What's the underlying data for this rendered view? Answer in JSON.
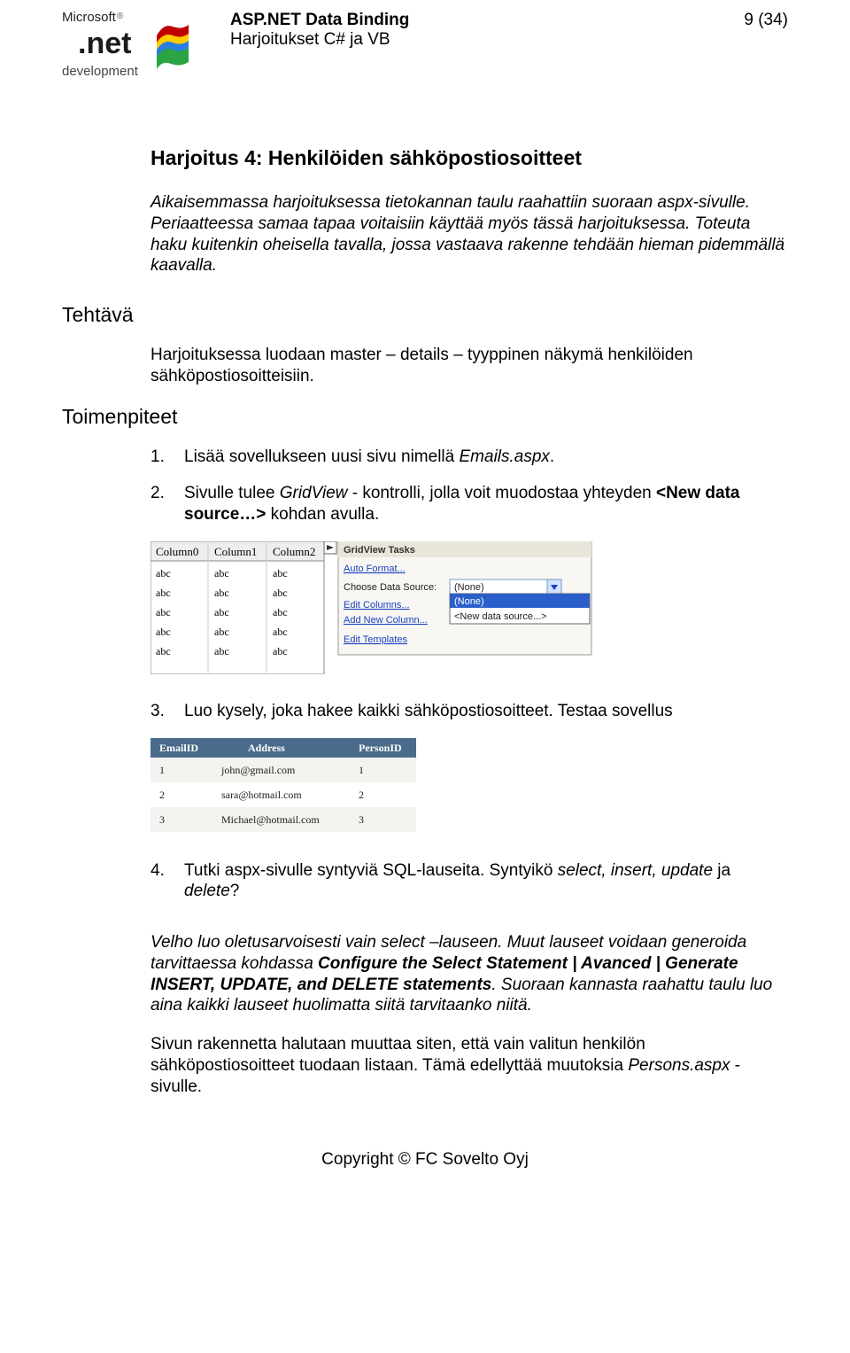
{
  "header": {
    "title": "ASP.NET Data Binding",
    "subtitle": "Harjoitukset C# ja VB",
    "pageInfo": "9 (34)",
    "logo": {
      "top": "Microsoft",
      "brand": ".net",
      "bottom": "development"
    }
  },
  "exercise": {
    "title_prefix": "Harjoitus 4: ",
    "title_bold": "Henkilöiden sähköpostiosoitteet",
    "intro": "Aikaisemmassa harjoituksessa tietokannan taulu raahattiin suoraan aspx-sivulle. Periaatteessa samaa tapaa voitaisiin käyttää myös tässä harjoituksessa. Toteuta haku kuitenkin oheisella tavalla, jossa vastaava rakenne tehdään hieman pidemmällä kaavalla."
  },
  "task": {
    "label": "Tehtävä",
    "text": "Harjoituksessa luodaan master – details – tyyppinen näkymä henkilöiden sähköpostiosoitteisiin."
  },
  "steps": {
    "label": "Toimenpiteet",
    "items": [
      {
        "num": "1.",
        "pre": "Lisää sovellukseen uusi sivu nimellä ",
        "em": "Emails.aspx",
        "post": "."
      },
      {
        "num": "2.",
        "pre": "Sivulle tulee ",
        "em": "GridView",
        "mid": " - kontrolli, jolla voit muodostaa yhteyden ",
        "bold": "<New data source…>",
        "post": " kohdan avulla."
      },
      {
        "num": "3.",
        "text": "Luo kysely, joka hakee kaikki sähköpostiosoitteet. Testaa sovellus"
      },
      {
        "num": "4.",
        "pre": "Tutki aspx-sivulle syntyviä SQL-lauseita. Syntyikö ",
        "em": "select, insert, update",
        "mid": " ja ",
        "em2": "delete",
        "post": "?"
      }
    ]
  },
  "para1": {
    "em1": "Velho luo oletusarvoisesti vain select –lauseen. Muut lauseet voidaan generoida tarvittaessa kohdassa ",
    "bold": "Configure the Select Statement | Avanced | Generate INSERT, UPDATE, and DELETE statements",
    "em2": ". Suoraan kannasta raahattu taulu luo aina kaikki lauseet huolimatta siitä tarvitaanko niitä."
  },
  "para2": {
    "pre": "Sivun rakennetta halutaan muuttaa siten, että vain valitun henkilön sähköpostiosoitteet tuodaan listaan. Tämä edellyttää muutoksia ",
    "em": "Persons.aspx",
    "post": " - sivulle."
  },
  "screenshot1": {
    "gridTitle": "GridView Tasks",
    "autoFormat": "Auto Format...",
    "chooseDS": "Choose Data Source:",
    "selected": "(None)",
    "opt1": "(None)",
    "opt2": "<New data source...>",
    "editCols": "Edit Columns...",
    "addNewCol": "Add New Column...",
    "editTpl": "Edit Templates",
    "cols": [
      "Column0",
      "Column1",
      "Column2"
    ],
    "cell": "abc"
  },
  "screenshot2": {
    "headers": [
      "EmailID",
      "Address",
      "PersonID"
    ],
    "rows": [
      [
        "1",
        "john@gmail.com",
        "1"
      ],
      [
        "2",
        "sara@hotmail.com",
        "2"
      ],
      [
        "3",
        "Michael@hotmail.com",
        "3"
      ]
    ]
  },
  "footer": "Copyright ©  FC Sovelto Oyj"
}
